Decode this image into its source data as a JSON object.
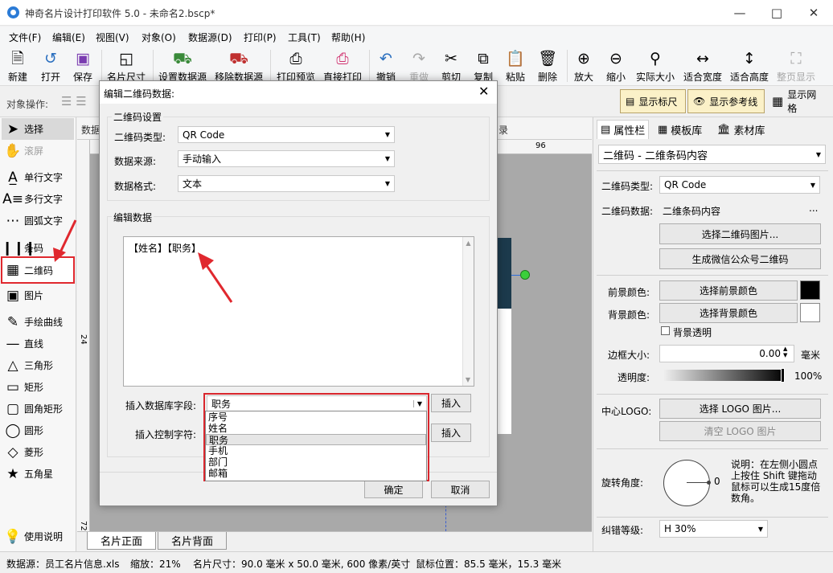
{
  "window": {
    "title": "神奇名片设计打印软件 5.0 - 未命名2.bscp*"
  },
  "menu": [
    "文件(F)",
    "编辑(E)",
    "视图(V)",
    "对象(O)",
    "数据源(D)",
    "打印(P)",
    "工具(T)",
    "帮助(H)"
  ],
  "toolbar": {
    "new": "新建",
    "open": "打开",
    "save": "保存",
    "card_size": "名片尺寸",
    "set_datasource": "设置数据源",
    "remove_datasource": "移除数据源",
    "print_preview": "打印预览",
    "direct_print": "直接打印",
    "undo": "撤销",
    "redo": "重做",
    "cut": "剪切",
    "copy": "复制",
    "paste": "粘贴",
    "delete": "删除",
    "zoom_in": "放大",
    "zoom_out": "缩小",
    "actual_size": "实际大小",
    "fit_width": "适合宽度",
    "fit_height": "适合高度",
    "fit_page": "整页显示"
  },
  "object_bar": {
    "label": "对象操作:",
    "show_ruler": "显示标尺",
    "show_guides": "显示参考线",
    "show_grid": "显示网格"
  },
  "tools": [
    "选择",
    "滚屏",
    "单行文字",
    "多行文字",
    "圆弧文字",
    "条码",
    "二维码",
    "图片",
    "手绘曲线",
    "直线",
    "三角形",
    "矩形",
    "圆角矩形",
    "圆形",
    "菱形",
    "五角星"
  ],
  "help_label": "使用说明",
  "canvas": {
    "tab_front": "名片正面",
    "tab_back": "名片背面",
    "ruler_96": "96",
    "ruler_24": "24",
    "ruler_72": "72",
    "behind_text_1": "数据",
    "behind_text_2": "录"
  },
  "right_panel": {
    "tabs": [
      "属性栏",
      "模板库",
      "素材库"
    ],
    "object_select": "二维码 - 二维条码内容",
    "qr_type_label": "二维码类型:",
    "qr_type_value": "QR Code",
    "qr_data_label": "二维码数据:",
    "qr_data_value": "二维条码内容",
    "qr_data_more": "...",
    "select_qr_image": "选择二维码图片...",
    "gen_wechat_qr": "生成微信公众号二维码",
    "fg_label": "前景颜色:",
    "select_fg": "选择前景颜色",
    "bg_label": "背景颜色:",
    "select_bg": "选择背景颜色",
    "bg_transparent": "背景透明",
    "border_label": "边框大小:",
    "border_value": "0.00",
    "border_unit": "毫米",
    "opacity_label": "透明度:",
    "opacity_value": "100%",
    "logo_label": "中心LOGO:",
    "select_logo": "选择 LOGO 图片...",
    "clear_logo": "清空 LOGO 图片",
    "rotation_label": "旋转角度:",
    "rotation_value": "0",
    "rotation_note": "说明：在左侧小圆点上按住 Shift 键拖动鼠标可以生成15度倍数角。",
    "ecc_label": "纠错等级:",
    "ecc_value": "H 30%",
    "fg_color": "#000000",
    "bg_color": "#ffffff"
  },
  "status": {
    "datasource": "数据源：员工名片信息.xls",
    "zoom": "缩放：21%",
    "size": "名片尺寸：90.0 毫米 x 50.0 毫米, 600 像素/英寸",
    "pos": "鼠标位置：85.5 毫米，15.3 毫米"
  },
  "dialog": {
    "title": "编辑二维码数据:",
    "settings_group": "二维码设置",
    "type_label": "二维码类型:",
    "type_value": "QR Code",
    "source_label": "数据来源:",
    "source_value": "手动输入",
    "format_label": "数据格式:",
    "format_value": "文本",
    "edit_group": "编辑数据",
    "content": "【姓名】【职务】",
    "insert_field_label": "插入数据库字段:",
    "insert_field_value": "职务",
    "insert_btn": "插入",
    "insert_ctrl_label": "插入控制字符:",
    "insert_btn2": "插入",
    "ok": "确定",
    "cancel": "取消",
    "dropdown_options": [
      "序号",
      "姓名",
      "职务",
      "手机",
      "部门",
      "邮箱"
    ],
    "dropdown_selected": "职务"
  },
  "annotation_color": "#e0282e"
}
